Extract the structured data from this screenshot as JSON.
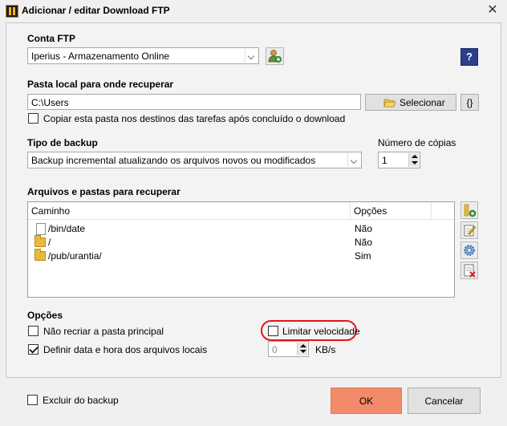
{
  "window": {
    "title": "Adicionar / editar Download FTP",
    "close_glyph": "✕"
  },
  "conta": {
    "label": "Conta FTP",
    "value": "Iperius - Armazenamento Online",
    "help_glyph": "?"
  },
  "pasta": {
    "label": "Pasta local para onde recuperar",
    "value": "C:\\Users",
    "select_label": "Selecionar",
    "vars_label": "{}",
    "copy_checkbox_label": "Copiar esta pasta nos destinos das tarefas após concluído o download",
    "copy_checked": false
  },
  "tipo": {
    "label": "Tipo de backup",
    "value": "Backup incremental atualizando os arquivos novos ou modificados"
  },
  "copias": {
    "label": "Número de cópias",
    "value": "1"
  },
  "arquivos": {
    "label": "Arquivos e pastas para recuperar",
    "columns": [
      "Caminho",
      "Opções"
    ],
    "rows": [
      {
        "icon": "file-icon",
        "path": "/bin/date",
        "option": "Não"
      },
      {
        "icon": "folder-icon",
        "path": "/",
        "option": "Não"
      },
      {
        "icon": "folder-icon",
        "path": "/pub/urantia/",
        "option": "Sim"
      }
    ]
  },
  "opcoes": {
    "label": "Opções",
    "nao_recriar_label": "Não recriar a pasta principal",
    "nao_recriar_checked": false,
    "definir_data_label": "Definir data e hora dos arquivos locais",
    "definir_data_checked": true,
    "limitar_label": "Limitar velocidade",
    "limitar_checked": false,
    "speed_value": "0",
    "speed_unit": "KB/s"
  },
  "footer": {
    "excluir_label": "Excluir do backup",
    "excluir_checked": false,
    "ok_label": "OK",
    "cancel_label": "Cancelar"
  },
  "colors": {
    "ok_button": "#f38a6a",
    "highlight": "#e8121a",
    "folder": "#e9b83c"
  }
}
